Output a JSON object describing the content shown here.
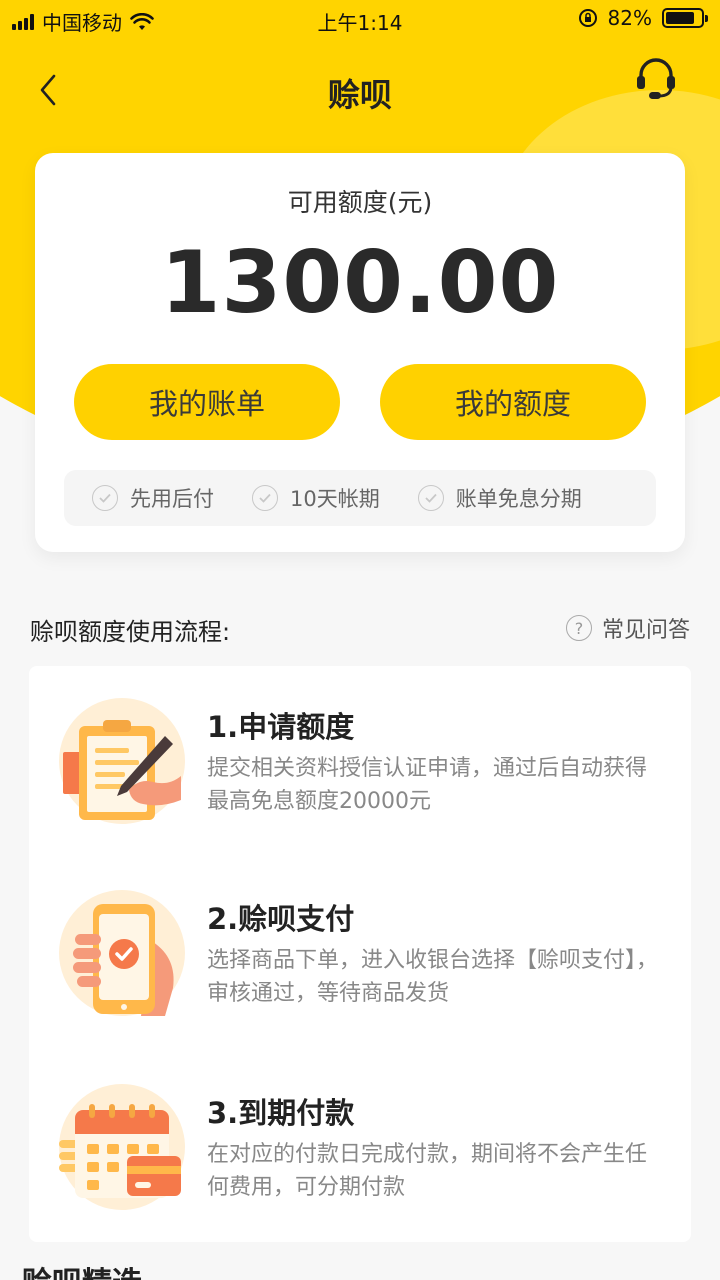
{
  "status_bar": {
    "carrier": "中国移动",
    "time": "上午1:14",
    "battery_percent": "82%",
    "battery_level": 0.82
  },
  "nav": {
    "title": "赊呗",
    "back_icon": "chevron-left-icon",
    "service_icon": "headset-icon"
  },
  "credit_card": {
    "label": "可用额度(元)",
    "amount": "1300.00",
    "bill_button": "我的账单",
    "quota_button": "我的额度",
    "features": [
      "先用后付",
      "10天帐期",
      "账单免息分期"
    ]
  },
  "process": {
    "title": "赊呗额度使用流程:",
    "faq_label": "常见问答",
    "steps": [
      {
        "title": "1.申请额度",
        "desc": "提交相关资料授信认证申请，通过后自动获得最高免息额度20000元",
        "icon": "clipboard-pen-icon"
      },
      {
        "title": "2.赊呗支付",
        "desc": "选择商品下单，进入收银台选择【赊呗支付】，审核通过，等待商品发货",
        "icon": "phone-check-icon"
      },
      {
        "title": "3.到期付款",
        "desc": "在对应的付款日完成付款，期间将不会产生任何费用，可分期付款",
        "icon": "calendar-card-icon"
      }
    ]
  },
  "next_section": {
    "title": "赊呗精选"
  },
  "colors": {
    "brand_yellow": "#FFD400",
    "button_yellow": "#FFD100",
    "icon_orange": "#F5794A",
    "icon_peach": "#FFEFD6"
  }
}
